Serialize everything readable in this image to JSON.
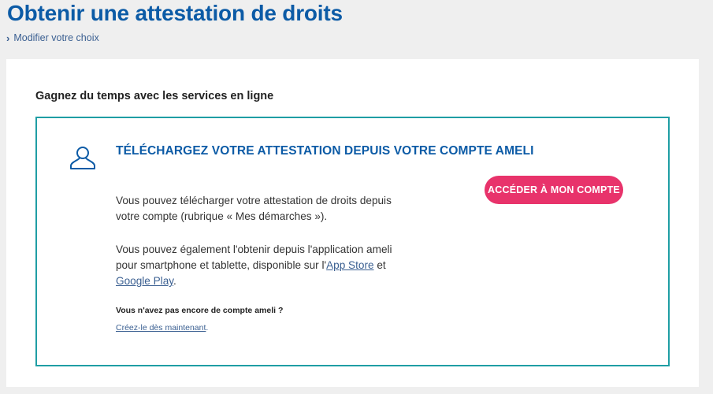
{
  "page": {
    "title": "Obtenir une attestation de droits",
    "back_link": "Modifier votre choix"
  },
  "section": {
    "heading": "Gagnez du temps avec les services en ligne"
  },
  "box": {
    "title": "TÉLÉCHARGEZ VOTRE ATTESTATION DEPUIS VOTRE COMPTE AMELI",
    "paragraph1": "Vous pouvez télécharger votre attestation de droits depuis votre compte (rubrique « Mes démarches »).",
    "paragraph2_before": "Vous pouvez également l'obtenir depuis l'application ameli pour smartphone et tablette, disponible sur l'",
    "app_store_link": "App Store",
    "paragraph2_middle": " et ",
    "google_play_link": "Google Play",
    "paragraph2_after": ".",
    "no_account_text": "Vous n'avez pas encore de compte ameli ?",
    "create_link": "Créez-le dès maintenant",
    "create_link_suffix": ".",
    "cta_label": "ACCÉDER À MON COMPTE"
  },
  "icons": {
    "back": "chevron-right-icon",
    "account": "user-icon"
  },
  "colors": {
    "title_blue": "#0c5ba6",
    "link_blue": "#3a5f91",
    "teal_border": "#1f9ea4",
    "cta_pink": "#e8336b",
    "page_bg": "#efefef"
  }
}
